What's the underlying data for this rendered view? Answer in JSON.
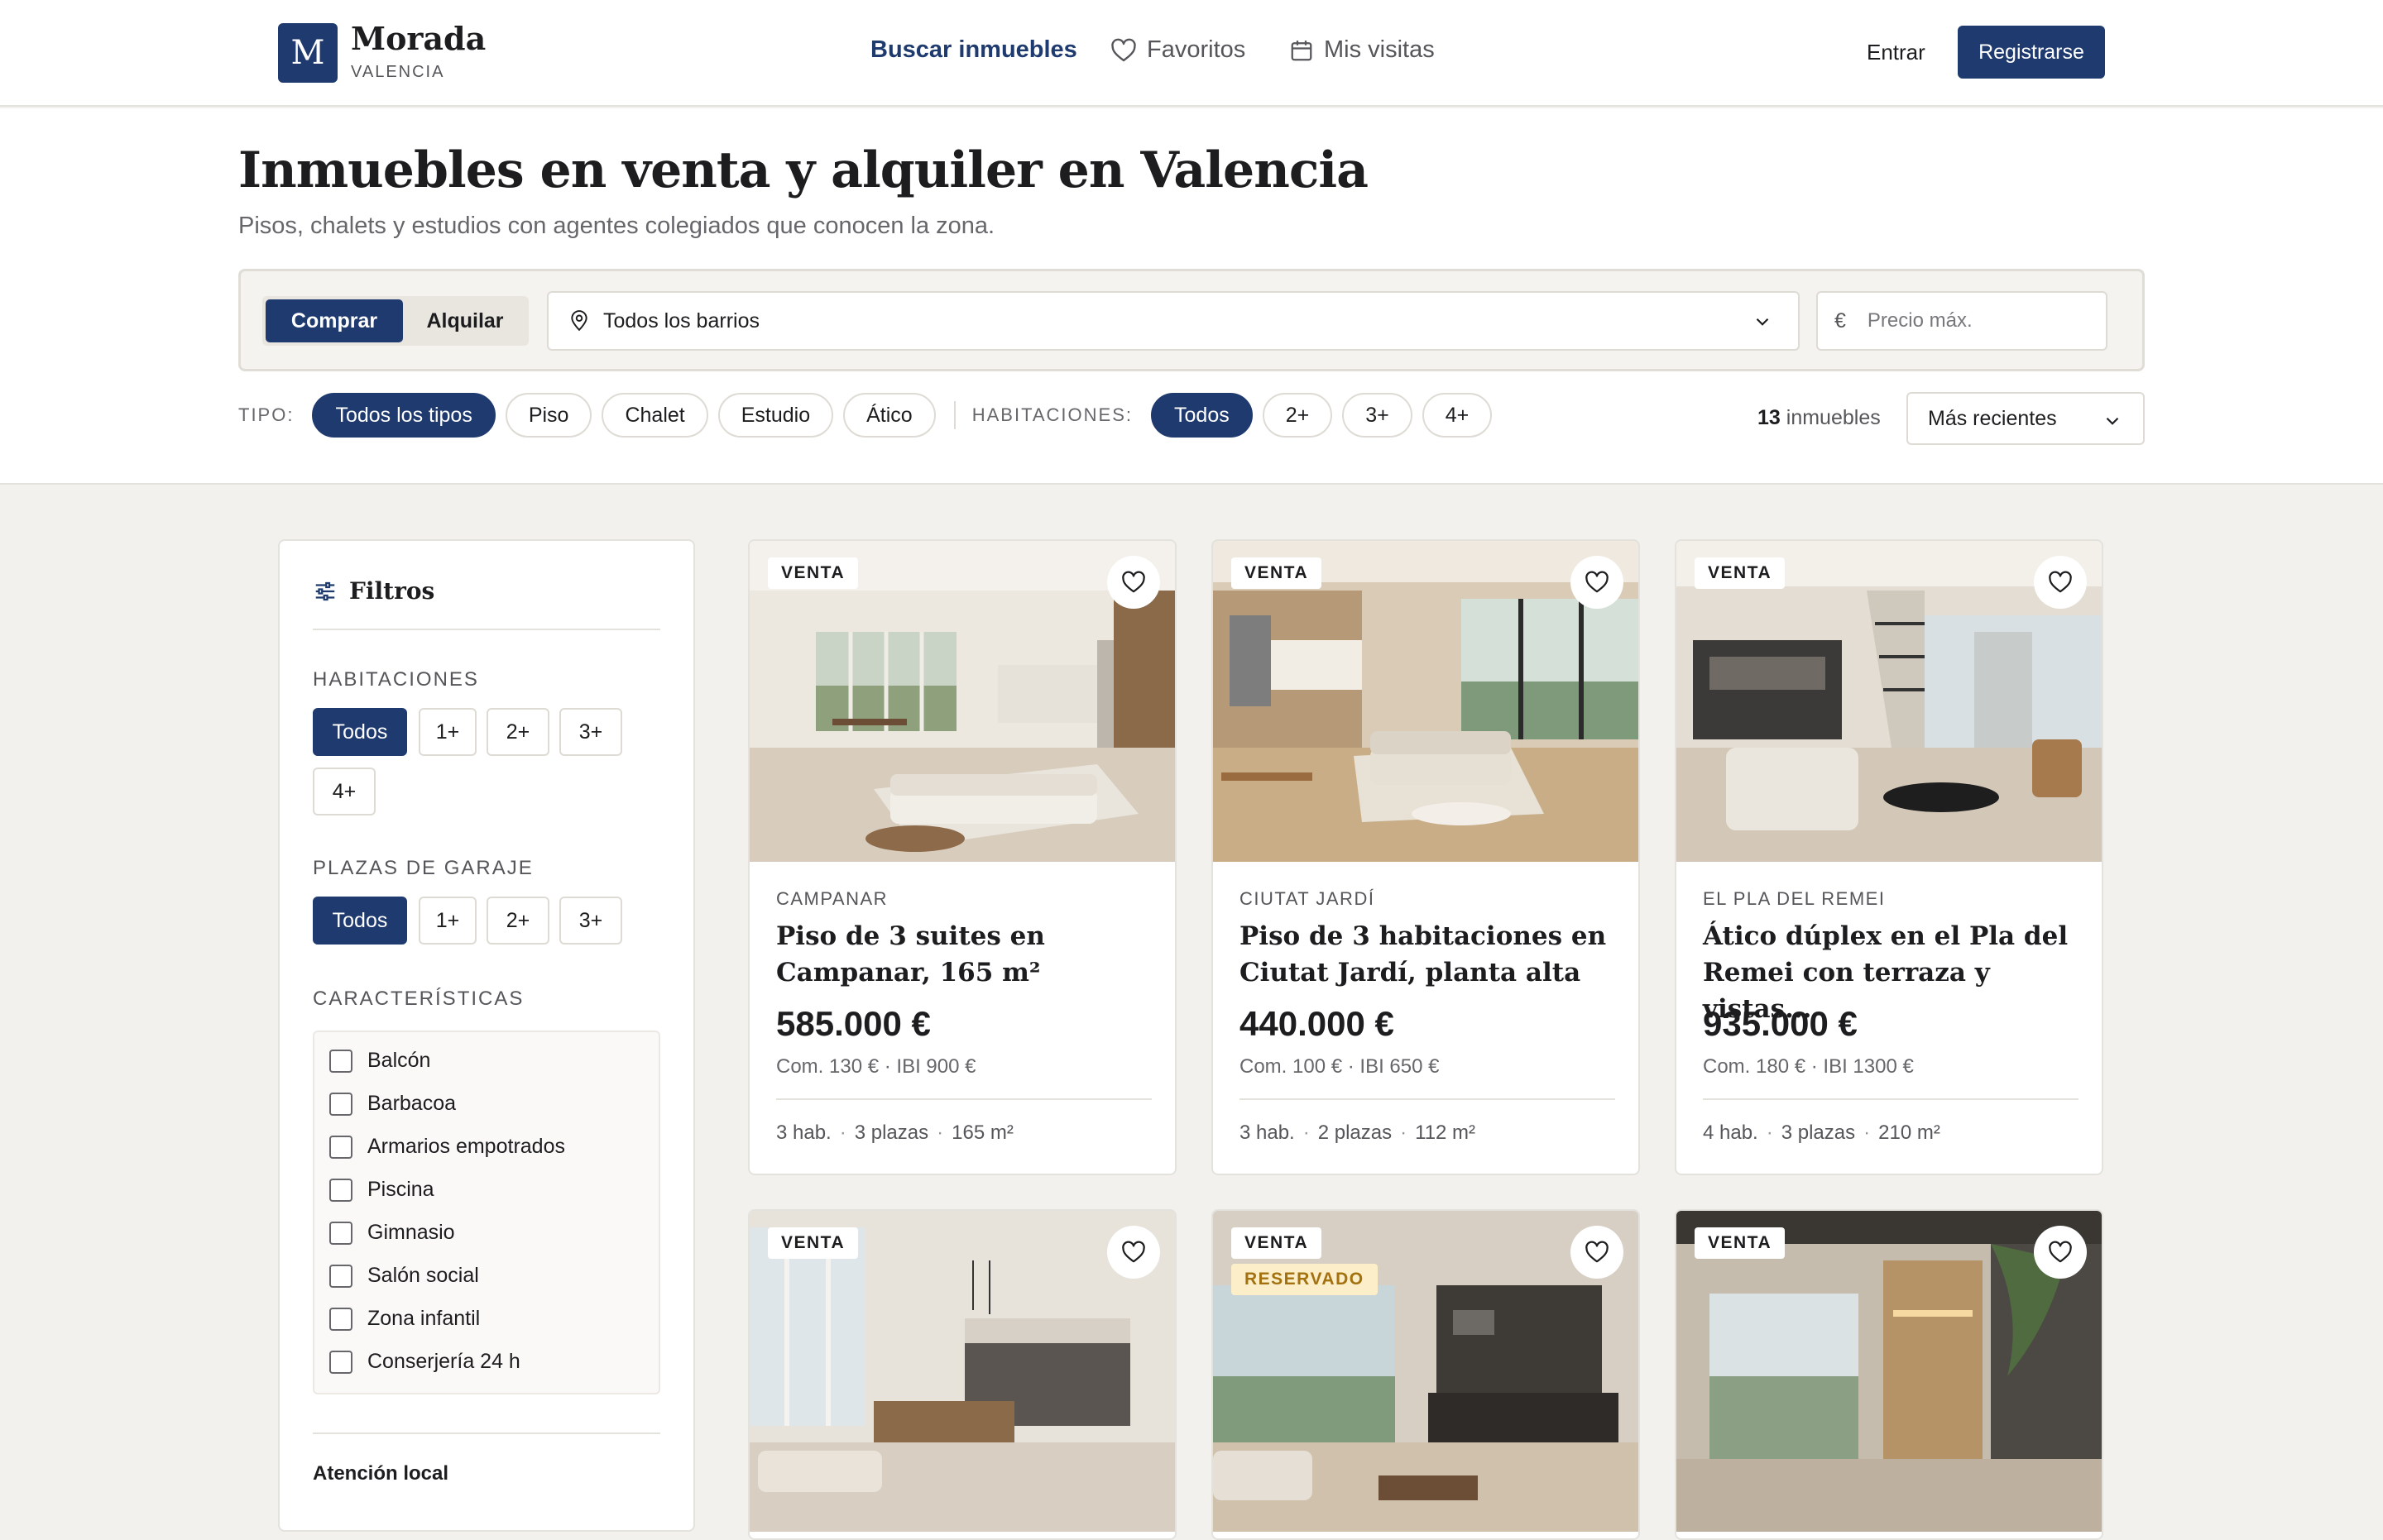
{
  "header": {
    "logo_letter": "M",
    "brand": "Morada",
    "city": "VALENCIA",
    "nav": [
      {
        "label": "Buscar inmuebles",
        "icon": "none"
      },
      {
        "label": "Favoritos",
        "icon": "heart-icon"
      },
      {
        "label": "Mis visitas",
        "icon": "calendar-icon"
      }
    ],
    "login": "Entrar",
    "register": "Registrarse"
  },
  "hero": {
    "title": "Inmuebles en venta y alquiler en Valencia",
    "subtitle": "Pisos, chalets y estudios con agentes colegiados que conocen la zona."
  },
  "search": {
    "mode_buy": "Comprar",
    "mode_rent": "Alquilar",
    "neighborhood": "Todos los barrios",
    "currency": "€",
    "price_placeholder": "Precio máx."
  },
  "filters": {
    "type_label": "TIPO:",
    "types": [
      "Todos los tipos",
      "Piso",
      "Chalet",
      "Estudio",
      "Ático"
    ],
    "rooms_label": "HABITACIONES:",
    "rooms": [
      "Todos",
      "2+",
      "3+",
      "4+"
    ],
    "count_number": "13",
    "count_text": "inmuebles",
    "sort": "Más recientes"
  },
  "sidebar": {
    "title": "Filtros",
    "rooms_heading": "HABITACIONES",
    "rooms": [
      "Todos",
      "1+",
      "2+",
      "3+",
      "4+"
    ],
    "garage_heading": "PLAZAS DE GARAJE",
    "garage": [
      "Todos",
      "1+",
      "2+",
      "3+"
    ],
    "features_heading": "CARACTERÍSTICAS",
    "features": [
      "Balcón",
      "Barbacoa",
      "Armarios empotrados",
      "Piscina",
      "Gimnasio",
      "Salón social",
      "Zona infantil",
      "Conserjería 24 h"
    ],
    "local_heading": "Atención local"
  },
  "listings": [
    {
      "badge": "VENTA",
      "area": "CAMPANAR",
      "title": "Piso de 3 suites en Campanar, 165 m²",
      "price": "585.000 €",
      "fees": "Com. 130 € · IBI 900 €",
      "rooms": "3 hab.",
      "parking": "3 plazas",
      "size": "165 m²"
    },
    {
      "badge": "VENTA",
      "area": "CIUTAT JARDÍ",
      "title": "Piso de 3 habitaciones en Ciutat Jardí, planta alta",
      "price": "440.000 €",
      "fees": "Com. 100 € · IBI 650 €",
      "rooms": "3 hab.",
      "parking": "2 plazas",
      "size": "112 m²"
    },
    {
      "badge": "VENTA",
      "area": "EL PLA DEL REMEI",
      "title": "Ático dúplex en el Pla del Remei con terraza y vistas...",
      "price": "935.000 €",
      "fees": "Com. 180 € · IBI 1300 €",
      "rooms": "4 hab.",
      "parking": "3 plazas",
      "size": "210 m²"
    },
    {
      "badge": "VENTA"
    },
    {
      "badge": "VENTA",
      "status": "RESERVADO"
    },
    {
      "badge": "VENTA"
    }
  ],
  "colors": {
    "accent": "#1f3a6e",
    "reserved_bg": "#fbeec8",
    "reserved_text": "#a3710f",
    "page_bg": "#f3f1ed"
  }
}
